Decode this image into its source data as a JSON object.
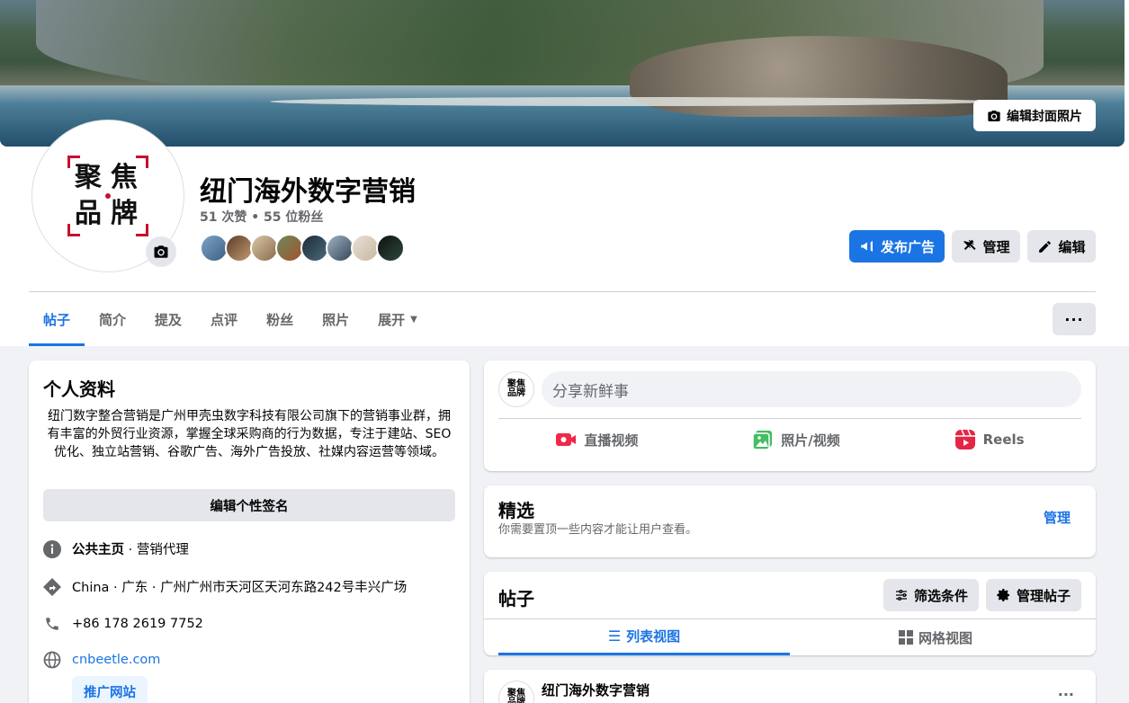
{
  "cover": {
    "edit_label": "编辑封面照片"
  },
  "profile": {
    "name": "纽门海外数字营销",
    "stats": "51 次赞 • 55 位粉丝",
    "logo_chars": [
      "聚",
      "焦",
      "品",
      "牌"
    ]
  },
  "actions": {
    "ad": "发布广告",
    "manage": "管理",
    "edit": "编辑"
  },
  "tabs": [
    "帖子",
    "简介",
    "提及",
    "点评",
    "粉丝",
    "照片",
    "展开"
  ],
  "intro": {
    "title": "个人资料",
    "bio": "纽门数字整合营销是广州甲壳虫数字科技有限公司旗下的营销事业群，拥有丰富的外贸行业资源，掌握全球采购商的行为数据，专注于建站、SEO优化、独立站营销、谷歌广告、海外广告投放、社媒内容运营等领域。",
    "edit_bio": "编辑个性签名",
    "category_bold": "公共主页",
    "category_rest": " · 营销代理",
    "address": "China · 广东 · 广州广州市天河区天河东路242号丰兴广场",
    "phone": "+86 178 2619 7752",
    "website": "cnbeetle.com",
    "promote": "推广网站"
  },
  "composer": {
    "placeholder": "分享新鲜事",
    "live": "直播视频",
    "photo": "照片/视频",
    "reels": "Reels"
  },
  "featured": {
    "title": "精选",
    "desc": "你需要置顶一些内容才能让用户查看。",
    "manage": "管理"
  },
  "posts": {
    "title": "帖子",
    "filter": "筛选条件",
    "manage": "管理帖子",
    "list_view": "列表视图",
    "grid_view": "网格视图",
    "first_author": "纽门海外数字营销"
  },
  "colors": {
    "accent": "#1b74e4",
    "brand_red": "#c8102e"
  }
}
